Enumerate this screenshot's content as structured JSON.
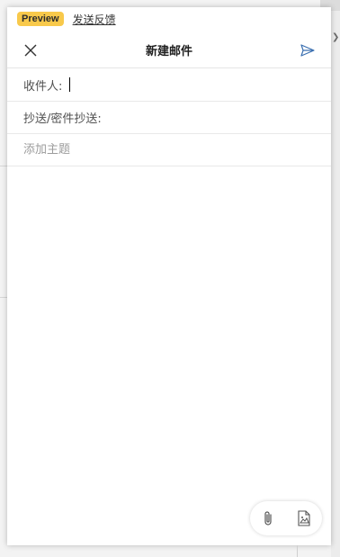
{
  "preview": {
    "badge": "Preview",
    "feedback_link": "发送反馈"
  },
  "compose": {
    "title": "新建邮件",
    "to_label": "收件人:",
    "cc_bcc_label": "抄送/密件抄送:",
    "subject_placeholder": "添加主题"
  },
  "icons": {
    "close": "close-icon",
    "send": "send-icon",
    "attach": "paperclip-icon",
    "image": "image-icon"
  },
  "colors": {
    "badge_bg": "#f8c94b",
    "send_icon": "#3a6fb0"
  }
}
